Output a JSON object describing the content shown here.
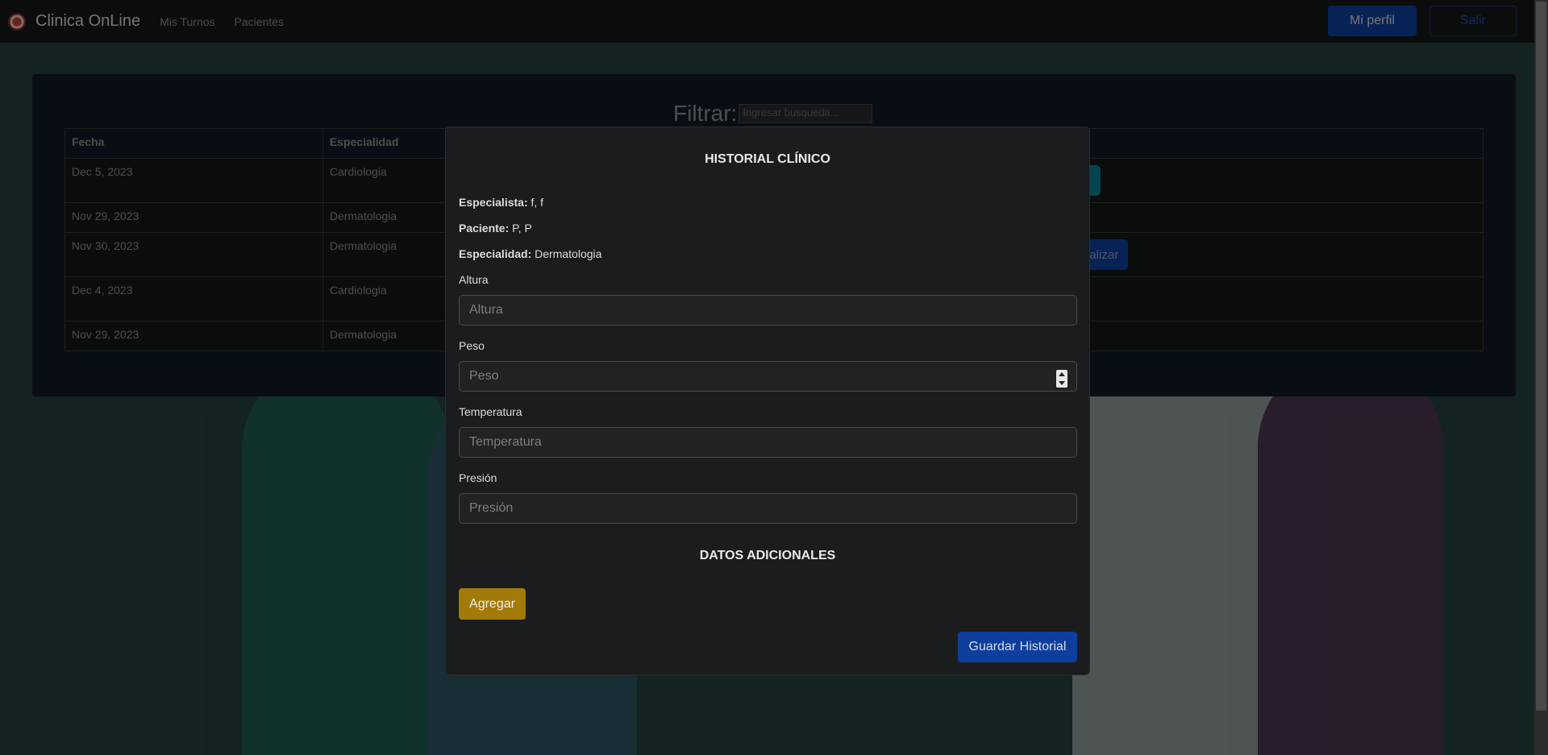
{
  "navbar": {
    "brand": "Clinica OnLine",
    "links": [
      "Mis Turnos",
      "Pacientes"
    ],
    "profile_button": "Mi perfil",
    "logout_button": "Salir"
  },
  "filter": {
    "label": "Filtrar:",
    "placeholder": "Ingresar busqueda..."
  },
  "table": {
    "headers": [
      "Fecha",
      "Especialidad"
    ],
    "rows": [
      {
        "fecha": "Dec 5, 2023",
        "especialidad": "Cardiologia"
      },
      {
        "fecha": "Nov 29, 2023",
        "especialidad": "Dermatologia"
      },
      {
        "fecha": "Nov 30, 2023",
        "especialidad": "Dermatologia"
      },
      {
        "fecha": "Dec 4, 2023",
        "especialidad": "Cardiologia"
      },
      {
        "fecha": "Nov 29, 2023",
        "especialidad": "Dermatologia"
      }
    ],
    "action_partial_label": "nalizar"
  },
  "modal": {
    "title": "HISTORIAL CLÍNICO",
    "especialista_label": "Especialista:",
    "especialista_value": "f, f",
    "paciente_label": "Paciente:",
    "paciente_value": "P, P",
    "especialidad_label": "Especialidad:",
    "especialidad_value": "Dermatologia",
    "fields": {
      "altura": {
        "label": "Altura",
        "placeholder": "Altura"
      },
      "peso": {
        "label": "Peso",
        "placeholder": "Peso"
      },
      "temperatura": {
        "label": "Temperatura",
        "placeholder": "Temperatura"
      },
      "presion": {
        "label": "Presión",
        "placeholder": "Presión"
      }
    },
    "additional_title": "DATOS ADICIONALES",
    "add_button": "Agregar",
    "save_button": "Guardar Historial"
  },
  "colors": {
    "primary": "#0d3e9c",
    "warning": "#a27a07",
    "info": "#0a7e94"
  }
}
